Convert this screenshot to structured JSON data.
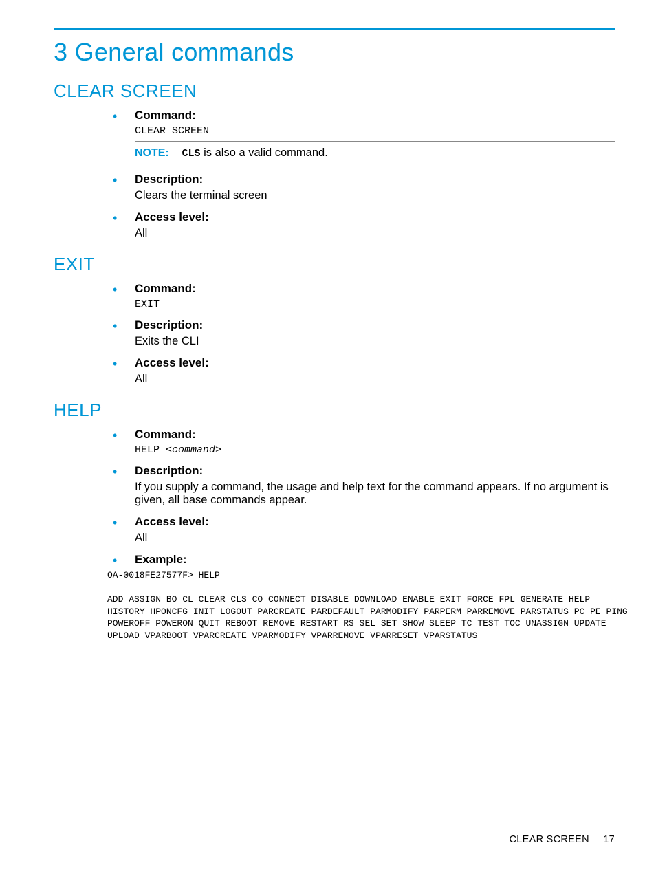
{
  "chapter_title": "3 General commands",
  "sections": {
    "clear_screen": {
      "title": "CLEAR SCREEN",
      "command_label": "Command:",
      "command_value": "CLEAR SCREEN",
      "note_label": "NOTE:",
      "note_code": "CLS",
      "note_rest": " is also a valid command.",
      "description_label": "Description:",
      "description_value": "Clears the terminal screen",
      "access_label": "Access level:",
      "access_value": "All"
    },
    "exit": {
      "title": "EXIT",
      "command_label": "Command:",
      "command_value": "EXIT",
      "description_label": "Description:",
      "description_value": "Exits the CLI",
      "access_label": "Access level:",
      "access_value": "All"
    },
    "help": {
      "title": "HELP",
      "command_label": "Command:",
      "command_value_prefix": "HELP ",
      "command_value_arg": "<command>",
      "description_label": "Description:",
      "description_value": "If you supply a command, the usage and help text for the command appears. If no argument is given, all base commands appear.",
      "access_label": "Access level:",
      "access_value": "All",
      "example_label": "Example:",
      "example_prompt": "OA-0018FE27577F> HELP",
      "example_output": "ADD ASSIGN BO CL CLEAR CLS CO CONNECT DISABLE DOWNLOAD ENABLE EXIT FORCE FPL GENERATE HELP HISTORY HPONCFG INIT LOGOUT PARCREATE PARDEFAULT PARMODIFY PARPERM PARREMOVE PARSTATUS PC PE PING POWEROFF POWERON QUIT REBOOT REMOVE RESTART RS SEL SET SHOW SLEEP TC TEST TOC UNASSIGN UPDATE UPLOAD VPARBOOT VPARCREATE VPARMODIFY VPARREMOVE VPARRESET VPARSTATUS"
    }
  },
  "footer": {
    "label": "CLEAR SCREEN",
    "page": "17"
  }
}
